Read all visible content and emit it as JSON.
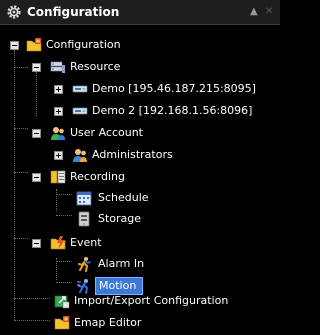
{
  "panel": {
    "title": "Configuration",
    "title_icon": "gear-icon",
    "collapse_glyph": "▲",
    "close_glyph": "✕"
  },
  "tree": {
    "root": {
      "label": "Configuration",
      "icon": "folder-config-icon"
    },
    "resource": {
      "label": "Resource",
      "icon": "server-icon"
    },
    "demo1": {
      "label": "Demo [195.46.187.215:8095]",
      "icon": "device-icon"
    },
    "demo2": {
      "label": "Demo 2 [192.168.1.56:8096]",
      "icon": "device-icon"
    },
    "user_account": {
      "label": "User Account",
      "icon": "users-icon"
    },
    "administrators": {
      "label": "Administrators",
      "icon": "admin-group-icon"
    },
    "recording": {
      "label": "Recording",
      "icon": "recording-icon"
    },
    "schedule": {
      "label": "Schedule",
      "icon": "calendar-icon"
    },
    "storage": {
      "label": "Storage",
      "icon": "storage-icon"
    },
    "event": {
      "label": "Event",
      "icon": "event-folder-icon"
    },
    "alarm_in": {
      "label": "Alarm In",
      "icon": "running-man-icon"
    },
    "motion": {
      "label": "Motion",
      "icon": "motion-icon"
    },
    "import_export": {
      "label": "Import/Export Configuration",
      "icon": "import-export-icon"
    },
    "emap_editor": {
      "label": "Emap Editor",
      "icon": "map-folder-icon"
    }
  },
  "colors": {
    "background": "#000000",
    "header": "#1e1e1e",
    "selection": "#3a79d6"
  }
}
